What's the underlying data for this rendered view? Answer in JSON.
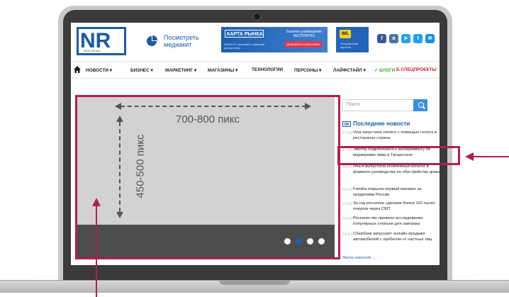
{
  "site": {
    "logo_text": "NR",
    "logo_sub": "NEW RETAIL",
    "media_kit": "Посмотреть медиакит",
    "banner": {
      "title": "КАРТА РЫНКА",
      "subtitle": "КАТАЛОГ решений и сервисов для ритейла",
      "offer": "Базовое размещение БЕСПЛАТНО",
      "button": "ДОБАВИТЬ КОМПАНИЮ"
    },
    "partner": {
      "logo": "IML",
      "text": "Генеральный партнер"
    },
    "social_icons": [
      "facebook-icon",
      "vk-icon",
      "telegram-icon",
      "twitter-icon",
      "mail-icon"
    ]
  },
  "nav": {
    "items": [
      {
        "label": "НОВОСТИ ▾"
      },
      {
        "label": "БИЗНЕС ▾"
      },
      {
        "label": "МАРКЕТИНГ ▾"
      },
      {
        "label": "МАГАЗИНЫ ▾"
      },
      {
        "label": "ТЕХНОЛОГИИ"
      },
      {
        "label": "ПЕРСОНЫ ▾"
      },
      {
        "label": "ЛАЙФСТАЙЛ ▾"
      },
      {
        "label": "✓ БЛОГИ"
      },
      {
        "label": "Б СПЕЦПРОЕКТЫ"
      }
    ]
  },
  "slider": {
    "width_label": "700-800 пикс",
    "height_label": "450-500 пикс",
    "dots": 4,
    "active_dot": 1
  },
  "sidebar": {
    "search_placeholder": "Поиск",
    "news_badge": "NR",
    "news_title": "Последние новости",
    "news": [
      {
        "time": "17:40",
        "text": "Visa запустила оплату с помощью голоса в ресторанах страны"
      },
      {
        "time": "17:16",
        "text": "Эвотор подключился к эксперименту по маркировке пива в Татарстане"
      },
      {
        "time": "16:55",
        "text": "ИКЕА выпустила юбилейный каталог в формате руководства по обустройству дома"
      },
      {
        "time": "16:33",
        "text": "Familia открыла первый магазин за пределами России"
      },
      {
        "time": "15:59",
        "text": "За год россияне сделали более 110 тысяч покупок через СБП"
      },
      {
        "time": "15:25",
        "text": "Роскачество провело исследование популярных хлопьев для завтрака"
      },
      {
        "time": "14:41",
        "text": "Сбербанк запускает онлайн-продажи автомобилей с пробегом от частных лиц"
      }
    ],
    "more_link": "Лента новостей →"
  },
  "colors": {
    "accent": "#b21e52",
    "brand": "#1a5aa6"
  }
}
